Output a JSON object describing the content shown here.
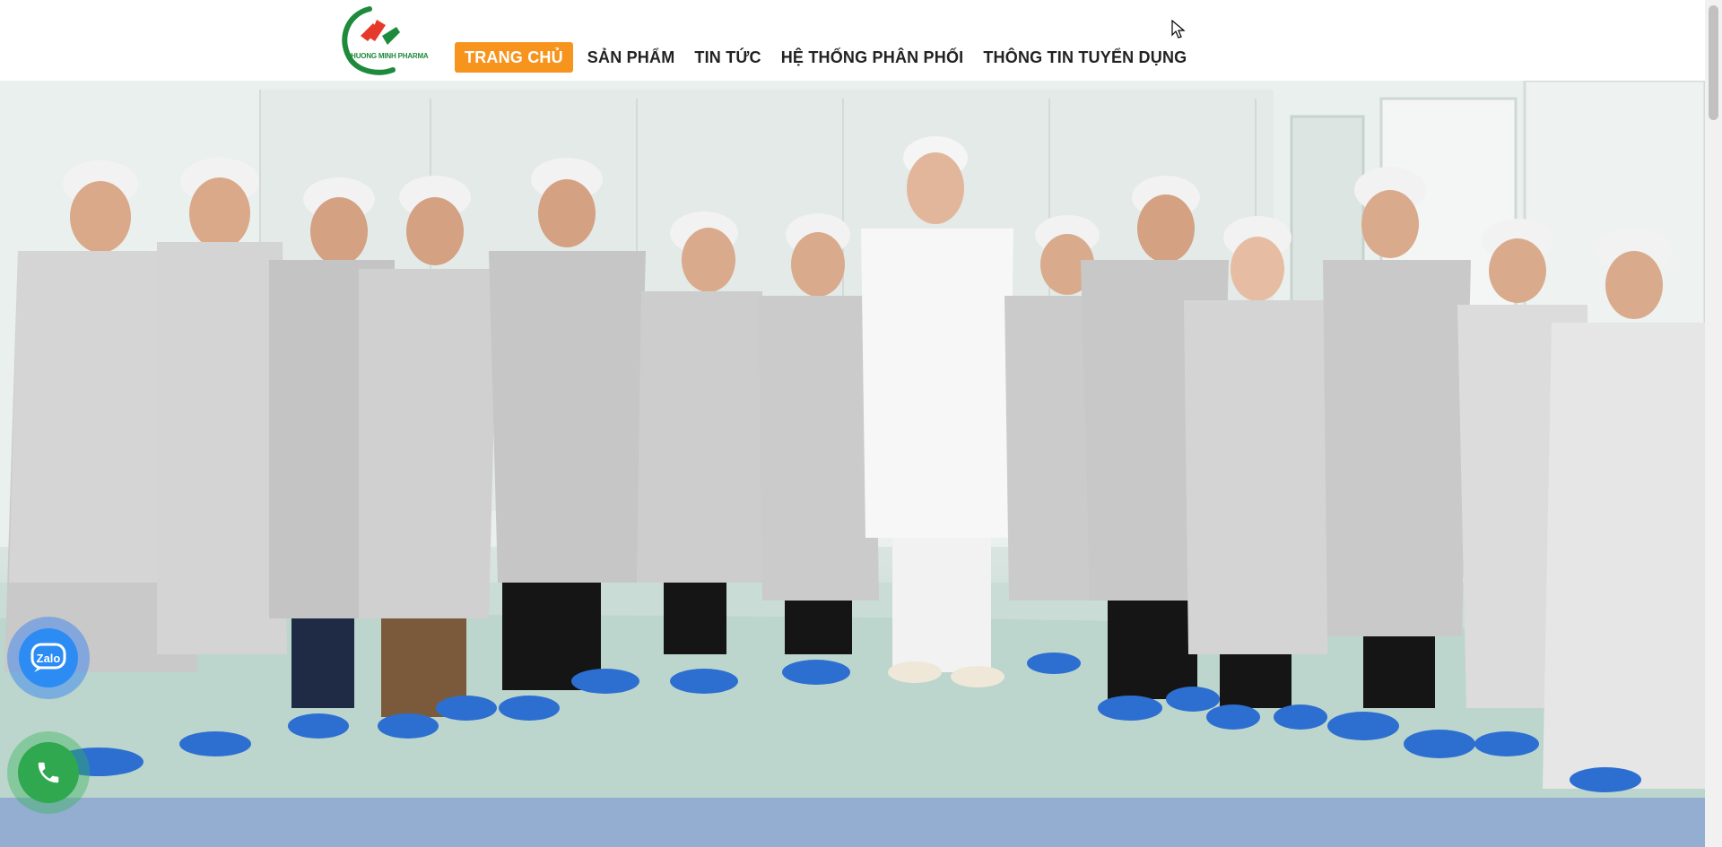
{
  "brand": {
    "logo_text": "PHUONG MINH PHARMA",
    "colors": {
      "green": "#1e8a3c",
      "red": "#e5392a",
      "accent": "#f7941d"
    }
  },
  "nav": {
    "items": [
      {
        "label": "TRANG CHỦ",
        "active": true
      },
      {
        "label": "SẢN PHẨM",
        "active": false
      },
      {
        "label": "TIN TỨC",
        "active": false
      },
      {
        "label": "HỆ THỐNG PHÂN PHỐI",
        "active": false
      },
      {
        "label": "THÔNG TIN TUYỂN DỤNG",
        "active": false
      }
    ]
  },
  "hero": {
    "slide_count": 7,
    "active_slide": 1,
    "image_subject": "group-photo-cleanroom"
  },
  "floating": {
    "zalo_label": "Zalo",
    "zalo_icon": "zalo-icon",
    "phone_icon": "phone-icon"
  }
}
